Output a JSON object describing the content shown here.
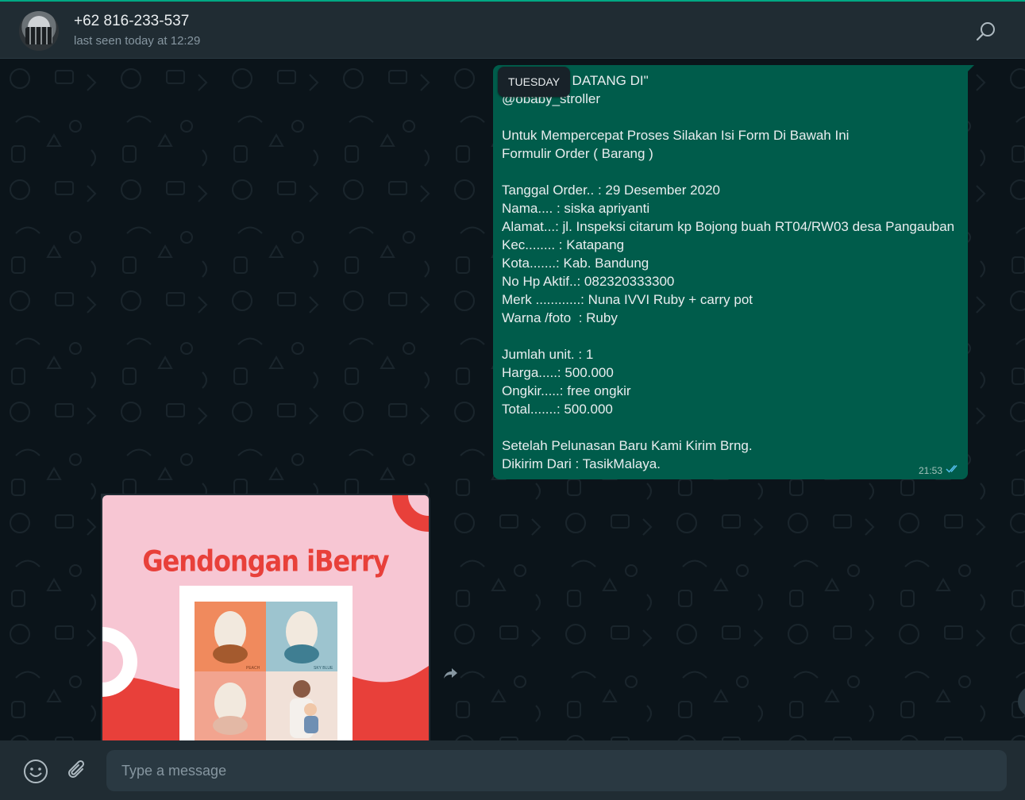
{
  "header": {
    "contact_name": "+62 816-233-537",
    "status": "last seen today at 12:29",
    "icons": {
      "avatar": "group-photo",
      "search": "search-icon"
    }
  },
  "chat": {
    "day_chip": "TUESDAY",
    "outgoing": {
      "text": "\"SELAMAT DATANG DI\"\n@obaby_stroller\n\nUntuk Mempercepat Proses Silakan Isi Form Di Bawah Ini\nFormulir Order ( Barang )\n\nTanggal Order.. : 29 Desember 2020\nNama.... : siska apriyanti\nAlamat...: jl. Inspeksi citarum kp Bojong buah RT04/RW03 desa Pangauban\nKec........ : Katapang\nKota.......: Kab. Bandung\nNo Hp Aktif..: 082320333300\nMerk ............: Nuna IVVI Ruby + carry pot\nWarna /foto  : Ruby\n\nJumlah unit. : 1\nHarga.....: 500.000\nOngkir.....: free ongkir\nTotal.......: 500.000\n\nSetelah Pelunasan Baru Kami Kirim Brng.\nDikirim Dari : TasikMalaya.",
      "time": "21:53",
      "status_icon": "double-check-icon"
    },
    "incoming_image": {
      "title": "Gendongan iBerry",
      "swatch_labels": [
        "PEACH",
        "SKY BLUE"
      ]
    }
  },
  "composer": {
    "placeholder": "Type a message",
    "icons": {
      "emoji": "emoji-icon",
      "attach": "paperclip-icon",
      "forward": "forward-icon"
    }
  },
  "colors": {
    "accent": "#00a884",
    "outgoing_bubble": "#005c4b",
    "header_bg": "#202c33",
    "chat_bg": "#0b141a"
  }
}
